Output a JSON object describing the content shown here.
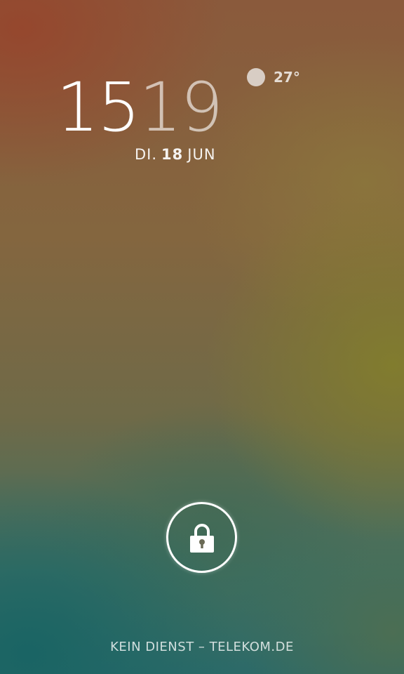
{
  "lockscreen": {
    "clock": {
      "hours": "15",
      "minutes": "19"
    },
    "date": {
      "weekday": "DI.",
      "day": "18",
      "month": "JUN"
    },
    "weather": {
      "icon": "weather-sun-icon",
      "temperature": "27°"
    },
    "unlock": {
      "icon": "lock-icon"
    },
    "carrier_text": "KEIN DIENST – TELEKOM.DE"
  },
  "colors": {
    "clock_minutes": "#ffffff9e",
    "unlock_ring": "#ffffff"
  }
}
